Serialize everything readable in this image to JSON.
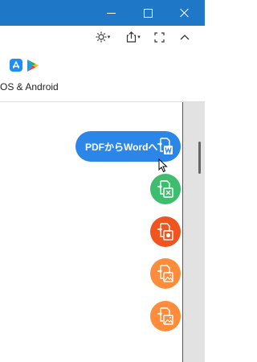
{
  "window": {
    "controls": {
      "minimize": "minimize-icon",
      "maximize": "maximize-icon",
      "close": "close-icon"
    },
    "title_bar_color": "#1f77c8"
  },
  "toolbar": {
    "icons": [
      "brightness-icon",
      "share-icon",
      "fullscreen-icon",
      "chevron-up-icon"
    ]
  },
  "store": {
    "text": "OS & Android",
    "icons": [
      "app-store-icon",
      "google-play-icon"
    ]
  },
  "convert_buttons": {
    "pdf_to_word_label": "PDFからWordへ",
    "items": [
      {
        "icon": "pdf-to-word-icon",
        "color": "#2b86e8"
      },
      {
        "icon": "pdf-to-excel-icon",
        "color": "#3dbd6d"
      },
      {
        "icon": "pdf-to-powerpoint-icon",
        "color": "#f0541f"
      },
      {
        "icon": "pdf-to-image-icon",
        "color": "#ff8c3a"
      },
      {
        "icon": "pdf-to-image-icon",
        "color": "#ff8c3a"
      }
    ]
  }
}
